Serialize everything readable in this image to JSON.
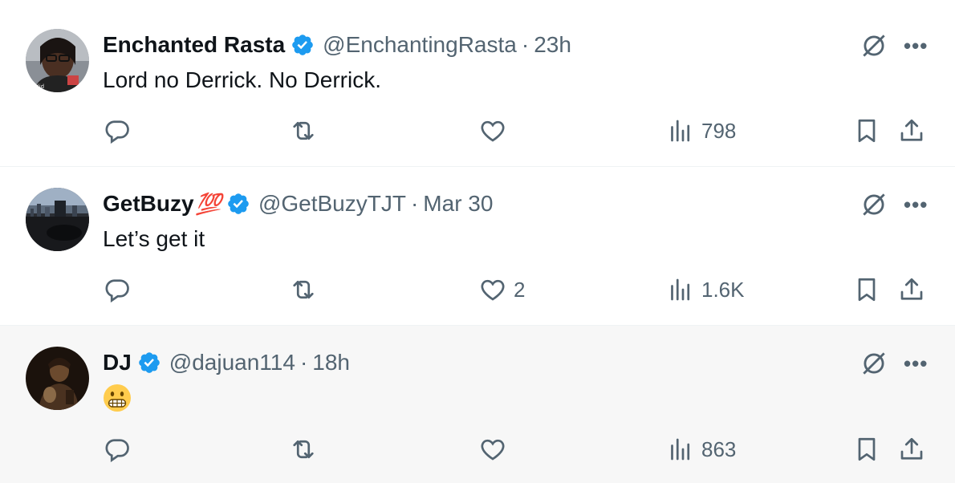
{
  "tweets": [
    {
      "name": "Enchanted Rasta",
      "name_badge": "",
      "handle": "@EnchantingRasta",
      "separator": "·",
      "time": "23h",
      "text": "Lord no Derrick. No Derrick.",
      "counts": {
        "reply": "",
        "retweet": "",
        "like": "",
        "views": "798"
      },
      "verified": true,
      "avatar": "portrait-woman-glasses"
    },
    {
      "name": "GetBuzy",
      "name_badge": "💯",
      "handle": "@GetBuzyTJT",
      "separator": "·",
      "time": "Mar 30",
      "text": "Let’s get it",
      "counts": {
        "reply": "",
        "retweet": "",
        "like": "2",
        "views": "1.6K"
      },
      "verified": true,
      "avatar": "city-skyline"
    },
    {
      "name": "DJ",
      "name_badge": "",
      "handle": "@dajuan114",
      "separator": "·",
      "time": "18h",
      "text": "",
      "emoji": "grimacing-face",
      "counts": {
        "reply": "",
        "retweet": "",
        "like": "",
        "views": "863"
      },
      "verified": true,
      "avatar": "dark-portrait"
    }
  ],
  "icons": {
    "reply": "reply-icon",
    "retweet": "retweet-icon",
    "like": "heart-icon",
    "views": "views-icon",
    "bookmark": "bookmark-icon",
    "share": "share-icon",
    "grok": "grok-icon",
    "more": "more-icon"
  },
  "colors": {
    "verified": "#1d9bf0",
    "secondary_text": "#536471",
    "primary_text": "#0f1419",
    "divider": "#eff3f4",
    "hover_bg": "#f7f7f7"
  },
  "more_label": "•••"
}
